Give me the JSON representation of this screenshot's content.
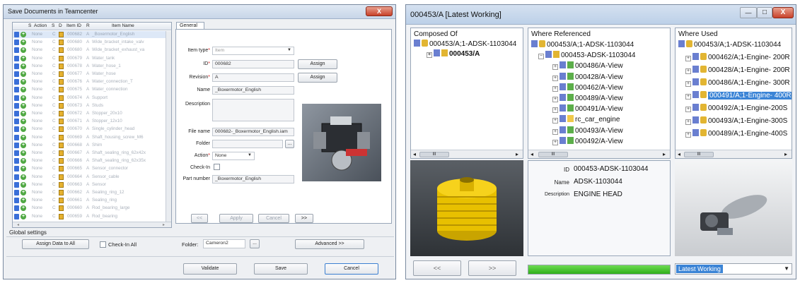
{
  "left_dialog": {
    "title": "Save Documents in Teamcenter",
    "close": "X",
    "grid": {
      "headers": [
        "S",
        "Action",
        "S",
        "D",
        "Item ID",
        "R",
        "Item Name"
      ],
      "rows": [
        {
          "action": "None",
          "s": "C",
          "id": "000682",
          "r": "A",
          "name": "_Boxermotor_English"
        },
        {
          "action": "None",
          "s": "C",
          "id": "000680",
          "r": "A",
          "name": "Wide_bracket_intake_valv"
        },
        {
          "action": "None",
          "s": "C",
          "id": "000680",
          "r": "A",
          "name": "Wide_bracket_exhaust_va"
        },
        {
          "action": "None",
          "s": "C",
          "id": "000679",
          "r": "A",
          "name": "Water_tank"
        },
        {
          "action": "None",
          "s": "C",
          "id": "000678",
          "r": "A",
          "name": "Water_hose_1"
        },
        {
          "action": "None",
          "s": "C",
          "id": "000677",
          "r": "A",
          "name": "Water_hose"
        },
        {
          "action": "None",
          "s": "C",
          "id": "000676",
          "r": "A",
          "name": "Water_connection_T"
        },
        {
          "action": "None",
          "s": "C",
          "id": "000675",
          "r": "A",
          "name": "Water_connection"
        },
        {
          "action": "None",
          "s": "C",
          "id": "000674",
          "r": "A",
          "name": "Support"
        },
        {
          "action": "None",
          "s": "C",
          "id": "000673",
          "r": "A",
          "name": "Studs"
        },
        {
          "action": "None",
          "s": "C",
          "id": "000672",
          "r": "A",
          "name": "Stopper_20x10"
        },
        {
          "action": "None",
          "s": "C",
          "id": "000671",
          "r": "A",
          "name": "Stopper_12x10"
        },
        {
          "action": "None",
          "s": "C",
          "id": "000670",
          "r": "A",
          "name": "Single_cylinder_head"
        },
        {
          "action": "None",
          "s": "C",
          "id": "000669",
          "r": "A",
          "name": "Shaft_housing_screw_M6"
        },
        {
          "action": "None",
          "s": "C",
          "id": "000668",
          "r": "A",
          "name": "Shim"
        },
        {
          "action": "None",
          "s": "C",
          "id": "000667",
          "r": "A",
          "name": "Shaft_sealing_ring_62x42x"
        },
        {
          "action": "None",
          "s": "C",
          "id": "000666",
          "r": "A",
          "name": "Shaft_sealing_ring_62x35x"
        },
        {
          "action": "None",
          "s": "C",
          "id": "000665",
          "r": "A",
          "name": "Sensor_connector"
        },
        {
          "action": "None",
          "s": "C",
          "id": "000664",
          "r": "A",
          "name": "Sensor_cable"
        },
        {
          "action": "None",
          "s": "C",
          "id": "000663",
          "r": "A",
          "name": "Sensor"
        },
        {
          "action": "None",
          "s": "C",
          "id": "000662",
          "r": "A",
          "name": "Sealing_ring_12"
        },
        {
          "action": "None",
          "s": "C",
          "id": "000661",
          "r": "A",
          "name": "Sealing_ring"
        },
        {
          "action": "None",
          "s": "C",
          "id": "000660",
          "r": "A",
          "name": "Rod_bearing_large"
        },
        {
          "action": "None",
          "s": "C",
          "id": "000659",
          "r": "A",
          "name": "Rod_bearing"
        }
      ]
    },
    "general_tab": "General",
    "form": {
      "item_type_label": "Item type",
      "item_type_value": "Item",
      "id_label": "ID",
      "id_value": "000682",
      "assign1": "Assign",
      "revision_label": "Revision",
      "revision_value": "A",
      "assign2": "Assign",
      "name_label": "Name",
      "name_value": "_Boxermotor_English",
      "description_label": "Description",
      "file_name_label": "File name",
      "file_name_value": "000682-_Boxermotor_English.iam",
      "folder_label": "Folder",
      "action_label": "Action",
      "action_value": "None",
      "checkin_label": "Check-In",
      "part_number_label": "Part number",
      "part_number_value": "_Boxermotor_English",
      "nav_prev": "<<",
      "apply": "Apply",
      "cancel_small": "Cancel",
      "nav_next": ">>"
    },
    "global_settings": "Global settings",
    "assign_all": "Assign Data to All",
    "checkin_all": "Check-In All",
    "folder_label": "Folder:",
    "folder_value": "Cameron2",
    "browse": "...",
    "advanced": "Advanced >>",
    "validate": "Validate",
    "save": "Save",
    "cancel": "Cancel"
  },
  "right_window": {
    "title": "000453/A [Latest Working]",
    "min": "—",
    "max": "□",
    "close": "X",
    "composed_of": {
      "header": "Composed Of",
      "items": [
        "000453/A;1-ADSK-1103044",
        "000453/A"
      ]
    },
    "where_referenced": {
      "header": "Where Referenced",
      "items": [
        "000453/A;1-ADSK-1103044",
        "000453-ADSK-1103044",
        "000486/A-View",
        "000428/A-View",
        "000462/A-View",
        "000489/A-View",
        "000491/A-View",
        "rc_car_engine",
        "000493/A-View",
        "000492/A-View"
      ]
    },
    "where_used": {
      "header": "Where Used",
      "items": [
        "000453/A;1-ADSK-1103044",
        "000462/A;1-Engine- 200R",
        "000428/A;1-Engine- 200R",
        "000486/A;1-Engine- 300R",
        "000491/A;1-Engine- 400R",
        "000492/A;1-Engine-200S",
        "000493/A;1-Engine-300S",
        "000489/A;1-Engine-400S"
      ],
      "selected_index": 4
    },
    "scroll_mark": "III",
    "props": {
      "id_label": "ID",
      "id_value": "000453-ADSK-1103044",
      "name_label": "Name",
      "name_value": "ADSK-1103044",
      "desc_label": "Description",
      "desc_value": "ENGINE HEAD"
    },
    "prev": "<<",
    "next": ">>",
    "progress": 1.0,
    "revision_rule": "Latest Working"
  }
}
